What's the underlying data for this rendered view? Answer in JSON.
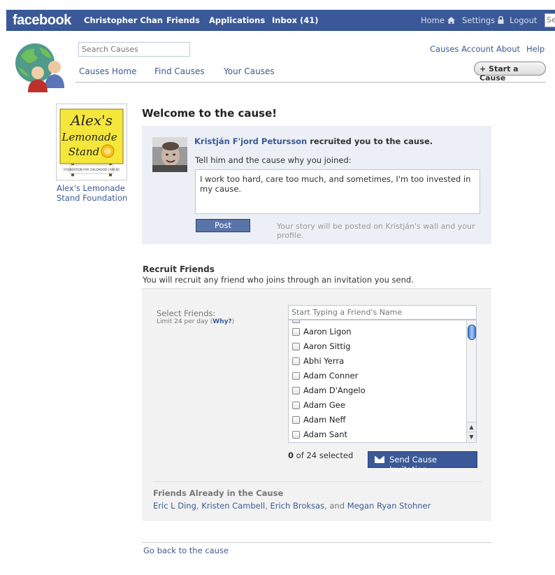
{
  "topbar": {
    "logo": "facebook",
    "user": "Christopher Chan",
    "friends": "Friends",
    "applications": "Applications",
    "inbox": "Inbox (41)",
    "home": "Home",
    "settings": "Settings",
    "logout": "Logout",
    "search_placeholder": "Se"
  },
  "app": {
    "search_placeholder": "Search Causes",
    "nav": {
      "home": "Causes Home",
      "find": "Find Causes",
      "yours": "Your Causes"
    },
    "links": {
      "account": "Causes Account",
      "about": "About",
      "help": "Help"
    },
    "start_cause": "+ Start a Cause"
  },
  "cause": {
    "name": "Alex's Lemonade Stand Foundation",
    "logo_text": {
      "l1": "Alex's",
      "l2": "Lemonade",
      "l3": "Stand",
      "sub": "FOUNDATION FOR CHILDHOOD CANCER"
    }
  },
  "welcome": {
    "title": "Welcome to the cause!",
    "recruiter": "Kristján F'jord Petursson",
    "recruited_text": " recruited you to the cause.",
    "tell_label": "Tell him and the cause why you joined:",
    "story_value": "I work too hard, care too much, and sometimes, I'm too invested in my cause.",
    "post": "Post",
    "post_note": "Your story will be posted on Kristján's wall and your profile."
  },
  "recruit": {
    "title": "Recruit Friends",
    "subtitle": "You will recruit any friend who joins through an invitation you send.",
    "select_label": "Select Friends:",
    "limit": "Limit 24 per day (",
    "why": "Why?",
    "limit_end": ")",
    "search_placeholder": "Start Typing a Friend's Name",
    "friends": [
      "Aaron Ligon",
      "Aaron Sittig",
      "Abhi Yerra",
      "Adam Conner",
      "Adam D'Angelo",
      "Adam Gee",
      "Adam Neff",
      "Adam Sant"
    ],
    "selected_count": "0",
    "selected_suffix": " of 24 selected",
    "send": "Send Cause Invitation",
    "already_title": "Friends Already in the Cause",
    "already": {
      "f1": "Eric L Ding",
      "f2": "Kristen Cambell",
      "f3": "Erich Broksas",
      "f4": "Megan Ryan Stohner",
      "sep": ", ",
      "and": ", and "
    }
  },
  "footer": {
    "go_back": "Go back to the cause"
  }
}
